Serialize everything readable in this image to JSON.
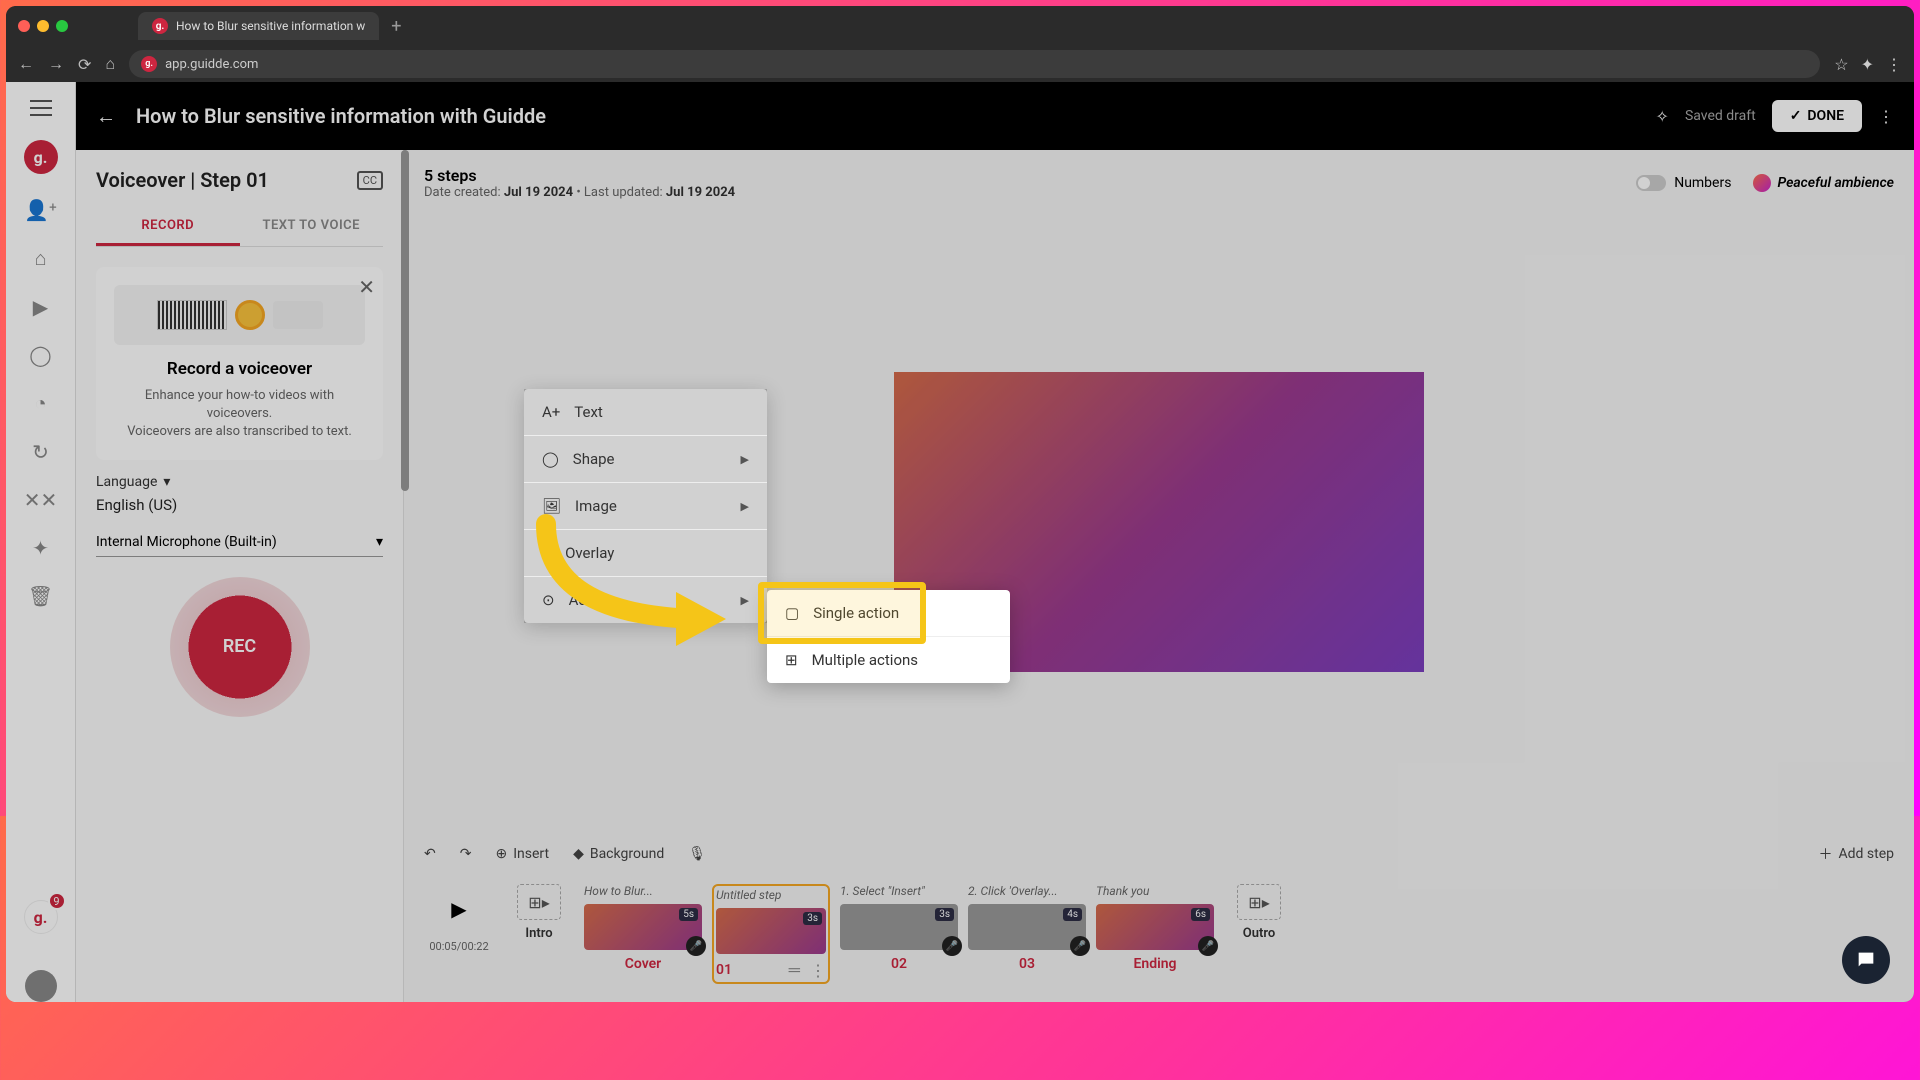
{
  "browser": {
    "tab_title": "How to Blur sensitive information w",
    "url": "app.guidde.com"
  },
  "topbar": {
    "title": "How to Blur sensitive information with Guidde",
    "saved": "Saved draft",
    "done": "DONE"
  },
  "panel": {
    "title": "Voiceover | Step 01",
    "tab_record": "RECORD",
    "tab_tts": "TEXT TO VOICE",
    "card_title": "Record a voiceover",
    "card_line1": "Enhance your how-to videos with voiceovers.",
    "card_line2": "Voiceovers are also transcribed to text.",
    "language_label": "Language",
    "language_value": "English (US)",
    "microphone": "Internal Microphone (Built-in)",
    "rec": "REC"
  },
  "canvas": {
    "steps_count": "5 steps",
    "created_label": "Date created: ",
    "created_date": "Jul 19 2024",
    "updated_label": " • Last updated: ",
    "updated_date": "Jul 19 2024",
    "numbers": "Numbers",
    "music": "Peaceful ambience"
  },
  "toolbar": {
    "insert": "Insert",
    "background": "Background",
    "add_step": "Add step"
  },
  "timeline": {
    "time": "00:05/00:22",
    "intro": "Intro",
    "outro": "Outro",
    "cover": "Cover",
    "ending": "Ending",
    "steps": [
      {
        "caption": "How to Blur...",
        "dur": "5s",
        "num": ""
      },
      {
        "caption": "Untitled step",
        "dur": "3s",
        "num": "01"
      },
      {
        "caption": "1. Select \"Insert\"",
        "dur": "3s",
        "num": "02"
      },
      {
        "caption": "2. Click 'Overlay...",
        "dur": "4s",
        "num": "03"
      },
      {
        "caption": "Thank you",
        "dur": "6s",
        "num": ""
      }
    ]
  },
  "menu": {
    "text": "Text",
    "shape": "Shape",
    "image": "Image",
    "overlay": "Overlay",
    "action": "Action",
    "single": "Single action",
    "multiple": "Multiple actions"
  },
  "rail": {
    "badge": "9"
  }
}
